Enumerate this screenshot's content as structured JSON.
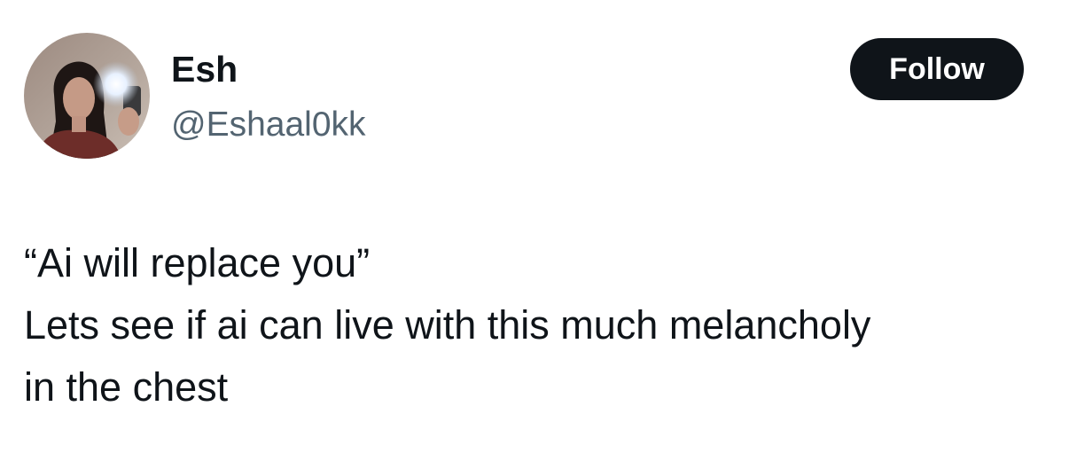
{
  "author": {
    "display_name": "Esh",
    "handle": "@Eshaal0kk",
    "avatar_icon": "profile-photo"
  },
  "actions": {
    "follow_label": "Follow"
  },
  "tweet": {
    "lines": [
      "“Ai will replace you”",
      "Lets see if ai can live with this much melancholy",
      "in the chest"
    ]
  },
  "colors": {
    "text_primary": "#0f1419",
    "text_secondary": "#536471",
    "button_bg": "#0f1419",
    "button_text": "#ffffff",
    "background": "#ffffff"
  }
}
